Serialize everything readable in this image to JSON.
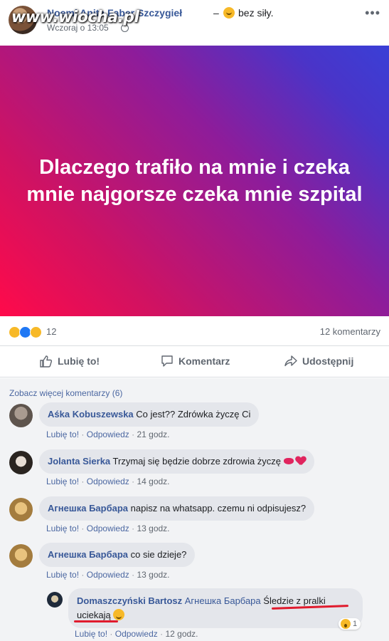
{
  "header": {
    "author": "Noemi Anita Faber Szczygieł",
    "dash": "–",
    "feeling": "bez siły.",
    "time": "Wczoraj o 13:05",
    "watermark": "www.wiocha.pl",
    "menu_icon": "more-icon"
  },
  "banner": {
    "text": "Dlaczego trafiło na mnie i czeka mnie najgorsze czeka mnie szpital",
    "gradient": [
      "#ff0a4a",
      "#8e1c9a",
      "#3a3fd6"
    ]
  },
  "stats": {
    "reactions": [
      "sad",
      "like",
      "wow"
    ],
    "reaction_count": "12",
    "comment_count": "12 komentarzy"
  },
  "actions": {
    "like": "Lubię to!",
    "comment": "Komentarz",
    "share": "Udostępnij"
  },
  "comments_more": "Zobacz więcej komentarzy (6)",
  "meta_labels": {
    "like": "Lubię to!",
    "reply": "Odpowiedz",
    "sep": "·"
  },
  "comments": [
    {
      "name": "Aśka Kobuszewska",
      "text": "Co jest?? Zdrówka życzę Ci",
      "time": "21 godz."
    },
    {
      "name": "Jolanta Sierka",
      "text": "Trzymaj się będzie dobrze zdrowia życzę",
      "time": "14 godz."
    },
    {
      "name": "Агнешка Барбара",
      "text": "napisz na whatsapp. czemu ni odpisujesz?",
      "time": "13 godz."
    },
    {
      "name": "Агнешка Барбара",
      "text": "co sie dzieje?",
      "time": "13 godz."
    }
  ],
  "reply": {
    "name": "Domaszczyński Bartosz",
    "mention": "Агнешка Барбара",
    "text_line1": "Śledzie z pralki",
    "text_line2": "uciekają",
    "time": "12 godz.",
    "reaction_count": "1"
  },
  "colors": {
    "link": "#385898",
    "accent_red": "#e01b2d"
  }
}
